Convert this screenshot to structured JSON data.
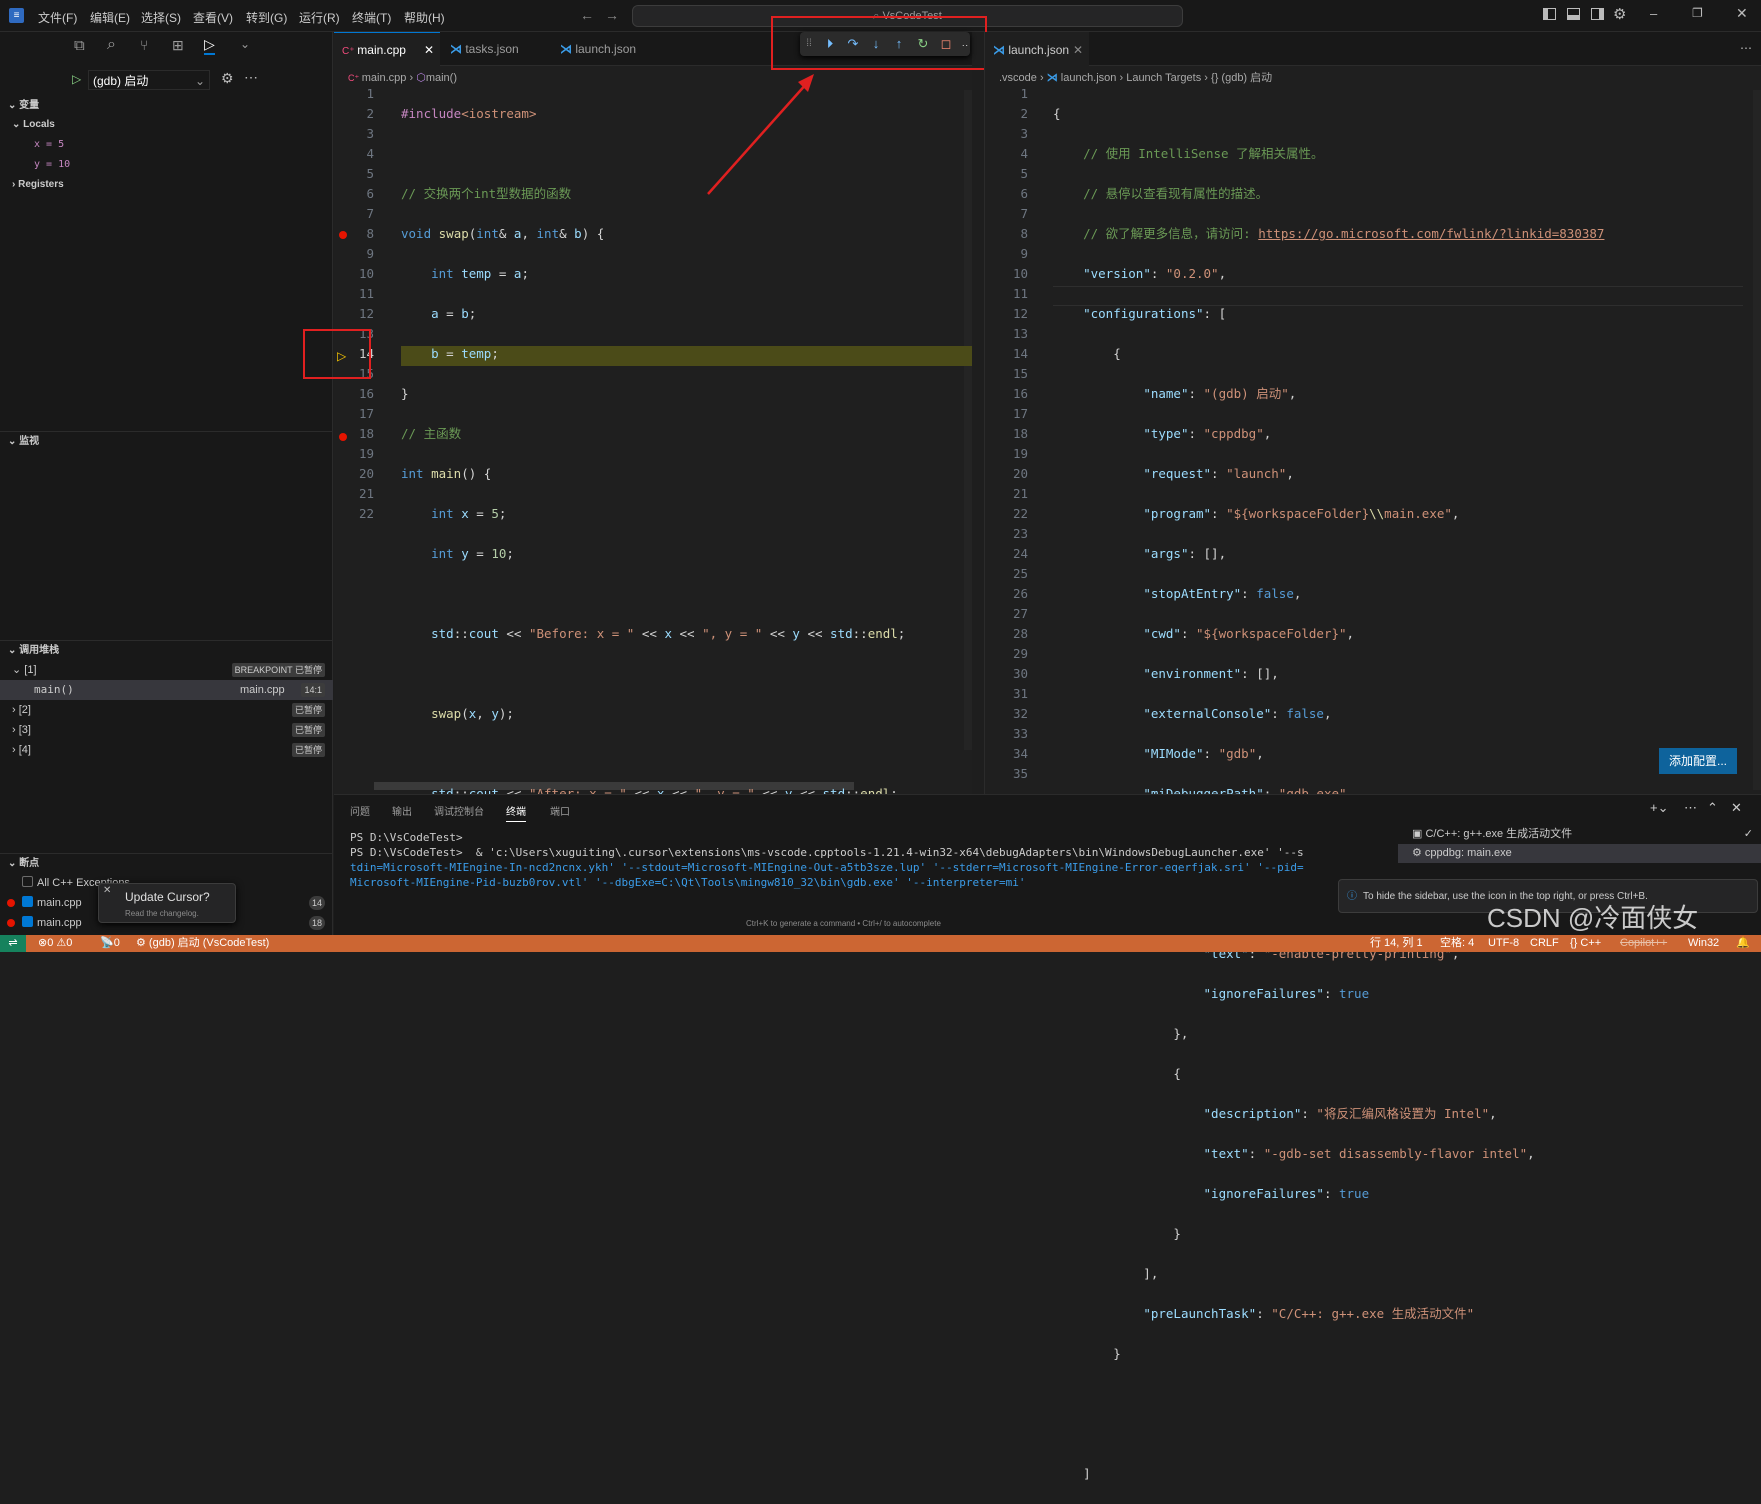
{
  "app": {
    "logo": "vscode-logo",
    "menu": [
      "文件(F)",
      "编辑(E)",
      "选择(S)",
      "查看(V)",
      "转到(G)",
      "运行(R)",
      "终端(T)",
      "帮助(H)"
    ],
    "command_center": "VsCodeTest"
  },
  "sidebar": {
    "debug_config": "(gdb) 启动",
    "variables_header": "变量",
    "locals_label": "Locals",
    "locals": [
      "x = 5",
      "y = 10"
    ],
    "registers_label": "Registers",
    "watch_header": "监视",
    "callstack_header": "调用堆栈",
    "callstack": {
      "thread1": "[1]",
      "thread1_badge": "BREAKPOINT",
      "paused": "已暂停",
      "frame_fn": "main()",
      "frame_file": "main.cpp",
      "frame_pos": "14:1",
      "thread2": "[2]",
      "thread3": "[3]",
      "thread4": "[4]"
    },
    "breakpoints_header": "断点",
    "breakpoints": [
      {
        "label": "All C++ Exceptions",
        "count": ""
      },
      {
        "label": "main.cpp",
        "count": "14"
      },
      {
        "label": "main.cpp",
        "count": "18"
      }
    ],
    "toast_title": "Update Cursor?",
    "toast_sub": "Read the changelog."
  },
  "editor1": {
    "tabs": [
      "main.cpp",
      "tasks.json",
      "launch.json"
    ],
    "crumb_file": "main.cpp",
    "crumb_fn": "main()",
    "line_numbers": [
      "1",
      "2",
      "3",
      "4",
      "5",
      "6",
      "7",
      "8",
      "9",
      "10",
      "11",
      "12",
      "13",
      "14",
      "15",
      "16",
      "17",
      "18",
      "19",
      "20",
      "21",
      "22"
    ]
  },
  "editor2": {
    "tab": "launch.json",
    "crumb_folder": ".vscode",
    "crumb_file": "launch.json",
    "crumb_path": "Launch Targets",
    "crumb_obj": "{} (gdb) 启动",
    "add_config": "添加配置...",
    "line_numbers": [
      "1",
      "2",
      "3",
      "4",
      "5",
      "6",
      "7",
      "8",
      "9",
      "10",
      "11",
      "12",
      "13",
      "14",
      "15",
      "16",
      "17",
      "18",
      "19",
      "20",
      "21",
      "22",
      "23",
      "24",
      "25",
      "26",
      "27",
      "28",
      "29",
      "30",
      "31",
      "32",
      "33",
      "34",
      "35"
    ]
  },
  "panel": {
    "tabs": [
      "问题",
      "输出",
      "调试控制台",
      "终端",
      "端口"
    ],
    "active_tab": "终端",
    "terminal_lines": [
      "PS D:\\VsCodeTest>",
      "PS D:\\VsCodeTest>  & 'c:\\Users\\xuguiting\\.cursor\\extensions\\ms-vscode.cpptools-1.21.4-win32-x64\\debugAdapters\\bin\\WindowsDebugLauncher.exe' '--s",
      "tdin=Microsoft-MIEngine-In-ncd2ncnx.ykh' '--stdout=Microsoft-MIEngine-Out-a5tb3sze.lup' '--stderr=Microsoft-MIEngine-Error-eqerfjak.sri' '--pid=",
      "Microsoft-MIEngine-Pid-buzb0rov.vtl' '--dbgExe=C:\\Qt\\Tools\\mingw810_32\\bin\\gdb.exe' '--interpreter=mi'"
    ],
    "hint": "Ctrl+K to generate a command • Ctrl+/ to autocomplete",
    "terminals": [
      "C/C++: g++.exe 生成活动文件",
      "cppdbg: main.exe"
    ],
    "notice": "To hide the sidebar, use the icon in the top right, or press Ctrl+B."
  },
  "status": {
    "errors": "0",
    "warnings": "0",
    "ports": "0",
    "debug": "(gdb) 启动 (VsCodeTest)",
    "cursor": "行 14, 列 1",
    "spaces": "空格: 4",
    "encoding": "UTF-8",
    "eol": "CRLF",
    "lang": "C++",
    "copilot": "Copilot++",
    "platform": "Win32"
  },
  "watermark": "CSDN @冷面侠女",
  "colors": {
    "accent": "#0078d4",
    "status_bg": "#cc6633",
    "annotation": "#e02020",
    "current_line": "#4b4b18"
  }
}
